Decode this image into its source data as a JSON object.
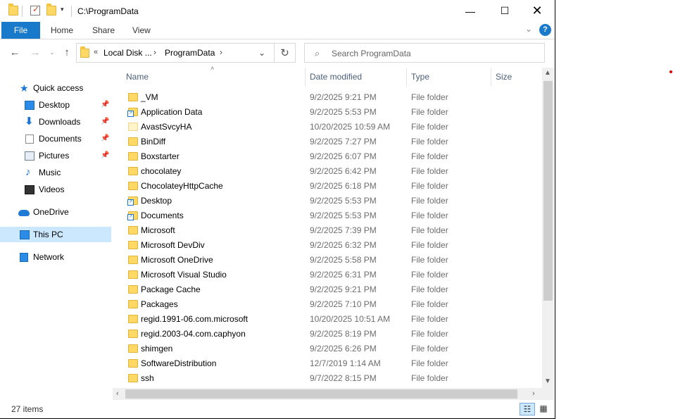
{
  "window": {
    "title": "C:\\ProgramData",
    "controls": {
      "minimize": "—",
      "maximize": "☐",
      "close": "✕"
    }
  },
  "quick_access_toolbar": {
    "dropdown": "▾"
  },
  "ribbon": {
    "tabs": [
      "File",
      "Home",
      "Share",
      "View"
    ],
    "expand": "⌄",
    "help": "?"
  },
  "navigation": {
    "back": "←",
    "forward": "→",
    "recent": "⌄",
    "up": "↑",
    "address": {
      "overflow": "«",
      "crumbs": [
        "Local Disk ...",
        "ProgramData"
      ],
      "separator": "›",
      "dropdown": "⌄"
    },
    "refresh": "↻",
    "search": {
      "placeholder": "Search ProgramData",
      "value": ""
    }
  },
  "nav_pane": {
    "quick_access": "Quick access",
    "pinned": [
      {
        "label": "Desktop",
        "icon": "desktop-icon",
        "pin": "📌"
      },
      {
        "label": "Downloads",
        "icon": "downloads-icon",
        "pin": "📌"
      },
      {
        "label": "Documents",
        "icon": "documents-icon",
        "pin": "📌"
      },
      {
        "label": "Pictures",
        "icon": "pictures-icon",
        "pin": "📌"
      }
    ],
    "others": [
      {
        "label": "Music",
        "icon": "music-icon"
      },
      {
        "label": "Videos",
        "icon": "videos-icon"
      }
    ],
    "onedrive": "OneDrive",
    "this_pc": "This PC",
    "network": "Network"
  },
  "columns": {
    "name": "Name",
    "date": "Date modified",
    "type": "Type",
    "size": "Size"
  },
  "files": [
    {
      "name": "_VM",
      "date": "9/2/2025 9:21 PM",
      "type": "File folder",
      "icon": "folder"
    },
    {
      "name": "Application Data",
      "date": "9/2/2025 5:53 PM",
      "type": "File folder",
      "icon": "folder-shortcut"
    },
    {
      "name": "AvastSvcyHA",
      "date": "10/20/2025 10:59 AM",
      "type": "File folder",
      "icon": "folder-hidden"
    },
    {
      "name": "BinDiff",
      "date": "9/2/2025 7:27 PM",
      "type": "File folder",
      "icon": "folder"
    },
    {
      "name": "Boxstarter",
      "date": "9/2/2025 6:07 PM",
      "type": "File folder",
      "icon": "folder"
    },
    {
      "name": "chocolatey",
      "date": "9/2/2025 6:42 PM",
      "type": "File folder",
      "icon": "folder"
    },
    {
      "name": "ChocolateyHttpCache",
      "date": "9/2/2025 6:18 PM",
      "type": "File folder",
      "icon": "folder"
    },
    {
      "name": "Desktop",
      "date": "9/2/2025 5:53 PM",
      "type": "File folder",
      "icon": "folder-shortcut"
    },
    {
      "name": "Documents",
      "date": "9/2/2025 5:53 PM",
      "type": "File folder",
      "icon": "folder-shortcut"
    },
    {
      "name": "Microsoft",
      "date": "9/2/2025 7:39 PM",
      "type": "File folder",
      "icon": "folder"
    },
    {
      "name": "Microsoft DevDiv",
      "date": "9/2/2025 6:32 PM",
      "type": "File folder",
      "icon": "folder"
    },
    {
      "name": "Microsoft OneDrive",
      "date": "9/2/2025 5:58 PM",
      "type": "File folder",
      "icon": "folder"
    },
    {
      "name": "Microsoft Visual Studio",
      "date": "9/2/2025 6:31 PM",
      "type": "File folder",
      "icon": "folder"
    },
    {
      "name": "Package Cache",
      "date": "9/2/2025 9:21 PM",
      "type": "File folder",
      "icon": "folder"
    },
    {
      "name": "Packages",
      "date": "9/2/2025 7:10 PM",
      "type": "File folder",
      "icon": "folder"
    },
    {
      "name": "regid.1991-06.com.microsoft",
      "date": "10/20/2025 10:51 AM",
      "type": "File folder",
      "icon": "folder"
    },
    {
      "name": "regid.2003-04.com.caphyon",
      "date": "9/2/2025 8:19 PM",
      "type": "File folder",
      "icon": "folder"
    },
    {
      "name": "shimgen",
      "date": "9/2/2025 6:26 PM",
      "type": "File folder",
      "icon": "folder"
    },
    {
      "name": "SoftwareDistribution",
      "date": "12/7/2019 1:14 AM",
      "type": "File folder",
      "icon": "folder"
    },
    {
      "name": "ssh",
      "date": "9/7/2022 8:15 PM",
      "type": "File folder",
      "icon": "folder"
    }
  ],
  "scrollbars": {
    "up": "▲",
    "down": "▼",
    "left": "‹",
    "right": "›"
  },
  "status": {
    "item_count": "27 items"
  },
  "views": {
    "details": "☷",
    "tiles": "▦"
  },
  "colors": {
    "accent": "#1979ca",
    "selection": "#cce8ff",
    "folder": "#ffd866"
  }
}
